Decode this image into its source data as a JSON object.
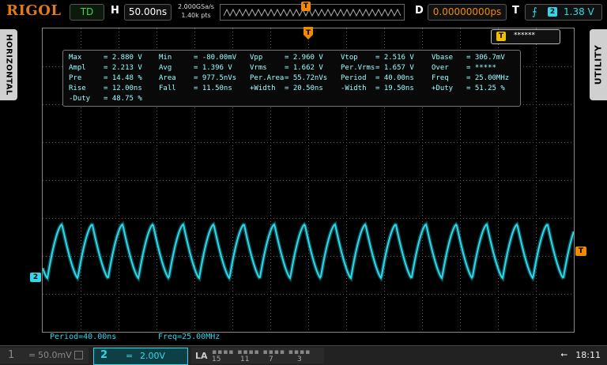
{
  "header": {
    "brand": "RIGOL",
    "run_state": "TD",
    "h_label": "H",
    "timebase": "50.00ns",
    "sample_rate": "2.000GSa/s",
    "mem_depth": "1.40k pts",
    "memory_marker": "T",
    "d_label": "D",
    "delay": "0.00000000ps",
    "t_label": "T",
    "trigger_edge": "⨍",
    "trigger_channel": "2",
    "trigger_level": "1.38 V"
  },
  "side_tabs": {
    "left": "HORIZONTAL",
    "right": "UTILITY"
  },
  "status": {
    "letter": "T",
    "value": "******"
  },
  "measurements": {
    "rows": [
      [
        [
          "Max",
          "= 2.880 V"
        ],
        [
          "Min",
          "= -80.00mV"
        ],
        [
          "Vpp",
          "= 2.960 V"
        ],
        [
          "Vtop",
          "= 2.516 V"
        ],
        [
          "Vbase",
          "= 306.7mV"
        ]
      ],
      [
        [
          "Ampl",
          "= 2.213 V"
        ],
        [
          "Avg",
          "= 1.396 V"
        ],
        [
          "Vrms",
          "= 1.662 V"
        ],
        [
          "Per.Vrms",
          "= 1.657 V"
        ],
        [
          "Over",
          "= *****"
        ]
      ],
      [
        [
          "Pre",
          "= 14.48 %"
        ],
        [
          "Area",
          "= 977.5nVs"
        ],
        [
          "Per.Area",
          "= 55.72nVs"
        ],
        [
          "Period",
          "= 40.00ns"
        ],
        [
          "Freq",
          "= 25.00MHz"
        ]
      ],
      [
        [
          "Rise",
          "= 12.00ns"
        ],
        [
          "Fall",
          "= 11.50ns"
        ],
        [
          "+Width",
          "= 20.50ns"
        ],
        [
          "-Width",
          "= 19.50ns"
        ],
        [
          "+Duty",
          "= 51.25 %"
        ]
      ],
      [
        [
          "-Duty",
          "= 48.75 %"
        ]
      ]
    ]
  },
  "bottom_measurements": {
    "period": "Period=40.00ns",
    "freq": "Freq=25.00MHz"
  },
  "markers": {
    "ch2": "2",
    "trigger": "T"
  },
  "waveform": {
    "period_ns": 40,
    "timebase_ns_per_div": 50,
    "color": "#2fd8e8"
  },
  "channels": {
    "ch1": {
      "num": "1",
      "coupling": "=",
      "scale": "50.0mV"
    },
    "ch2": {
      "num": "2",
      "coupling": "=",
      "scale": "2.00V"
    }
  },
  "la": {
    "label": "LA",
    "groups": [
      "15",
      "11",
      "7",
      "3"
    ]
  },
  "system": {
    "usb": "⭠",
    "time": "18:11"
  },
  "colors": {
    "ch2": "#2fd8e8",
    "trigger": "#f08a00",
    "brand": "#e07a1a"
  }
}
